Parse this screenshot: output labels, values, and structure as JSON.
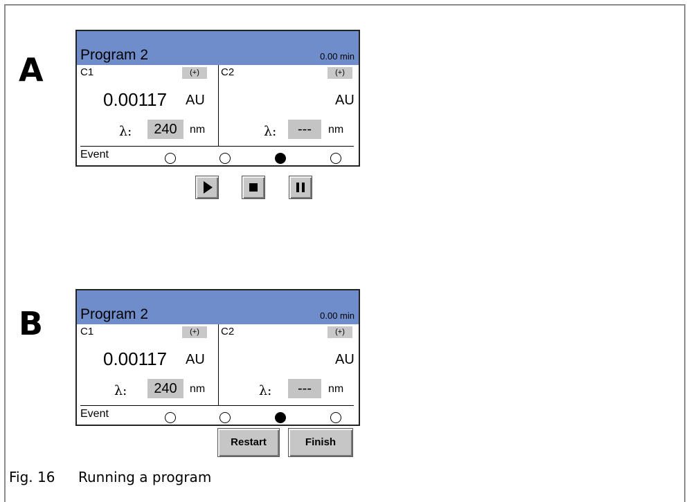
{
  "panels": [
    {
      "letter": "A",
      "program_title": "Program 2",
      "run_time": "0.00 min",
      "channels": [
        {
          "label": "C1",
          "plus": "(+)",
          "absorbance": "0.00117",
          "unit": "AU",
          "lambda_symbol": "λ:",
          "wavelength": "240",
          "wavelength_unit": "nm"
        },
        {
          "label": "C2",
          "plus": "(+)",
          "absorbance": "",
          "unit": "AU",
          "lambda_symbol": "λ:",
          "wavelength": "---",
          "wavelength_unit": "nm"
        }
      ],
      "event_label": "Event",
      "events": [
        false,
        false,
        true,
        false
      ],
      "controls": [
        "play-icon",
        "stop-icon",
        "pause-icon"
      ]
    },
    {
      "letter": "B",
      "program_title": "Program 2",
      "run_time": "0.00 min",
      "channels": [
        {
          "label": "C1",
          "plus": "(+)",
          "absorbance": "0.00117",
          "unit": "AU",
          "lambda_symbol": "λ:",
          "wavelength": "240",
          "wavelength_unit": "nm"
        },
        {
          "label": "C2",
          "plus": "(+)",
          "absorbance": "",
          "unit": "AU",
          "lambda_symbol": "λ:",
          "wavelength": "---",
          "wavelength_unit": "nm"
        }
      ],
      "event_label": "Event",
      "events": [
        false,
        false,
        true,
        false
      ],
      "buttons": [
        "Restart",
        "Finish"
      ]
    }
  ],
  "caption": {
    "number": "Fig. 16",
    "text": "Running a program"
  },
  "colors": {
    "title_bar": "#6f8ccb",
    "field_gray": "#c4c4c4",
    "button_gray": "#c6c6c6"
  }
}
